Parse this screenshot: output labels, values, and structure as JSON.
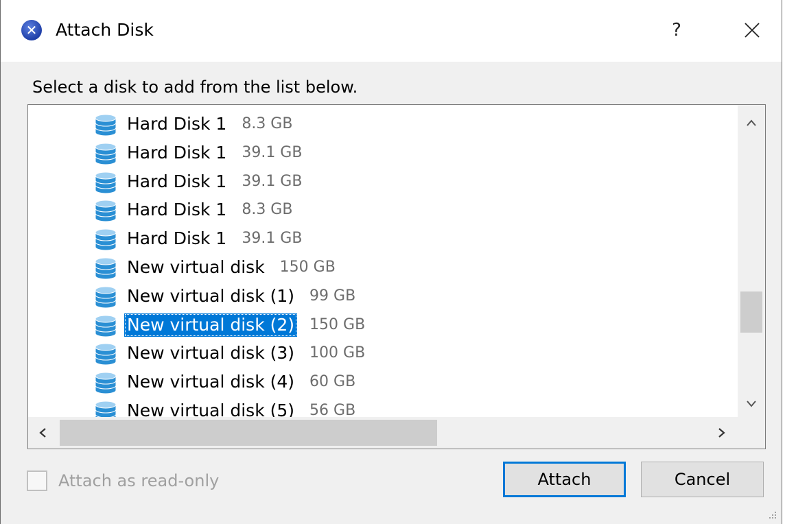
{
  "window": {
    "title": "Attach Disk",
    "help_label": "?",
    "app_icon": "x-logo-icon",
    "close_icon": "close-icon"
  },
  "prompt": "Select a disk to add from the list below.",
  "disks": [
    {
      "name": "Hard Disk 1",
      "size": "8.3 GB",
      "selected": false
    },
    {
      "name": "Hard Disk 1",
      "size": "39.1 GB",
      "selected": false
    },
    {
      "name": "Hard Disk 1",
      "size": "39.1 GB",
      "selected": false
    },
    {
      "name": "Hard Disk 1",
      "size": "8.3 GB",
      "selected": false
    },
    {
      "name": "Hard Disk 1",
      "size": "39.1 GB",
      "selected": false
    },
    {
      "name": "New virtual disk",
      "size": "150 GB",
      "selected": false
    },
    {
      "name": "New virtual disk (1)",
      "size": "99 GB",
      "selected": false
    },
    {
      "name": "New virtual disk (2)",
      "size": "150 GB",
      "selected": true
    },
    {
      "name": "New virtual disk (3)",
      "size": "100 GB",
      "selected": false
    },
    {
      "name": "New virtual disk (4)",
      "size": "60 GB",
      "selected": false
    },
    {
      "name": "New virtual disk (5)",
      "size": "56 GB",
      "selected": false
    }
  ],
  "options": {
    "readonly_label": "Attach as read-only",
    "readonly_checked": false,
    "readonly_enabled": false
  },
  "buttons": {
    "attach_label": "Attach",
    "cancel_label": "Cancel"
  },
  "colors": {
    "selection": "#0078d7",
    "size_text": "#6d6d6d",
    "disk_icon": "#2a8fd4"
  }
}
